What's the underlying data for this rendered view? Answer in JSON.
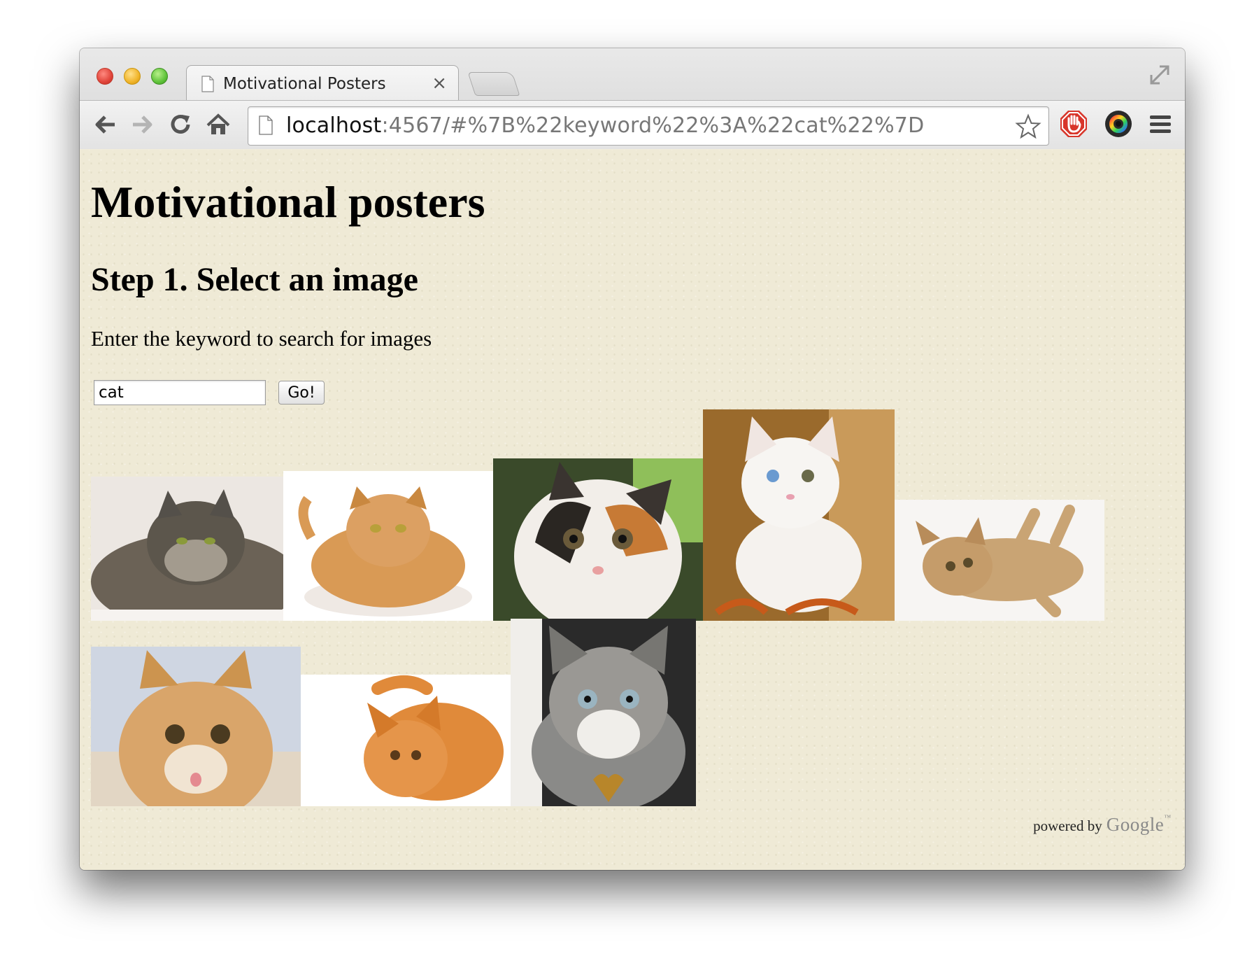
{
  "browser": {
    "tab_title": "Motivational Posters",
    "tab_close": "×",
    "url_host": "localhost",
    "url_rest": ":4567/#%7B%22keyword%22%3A%22cat%22%7D"
  },
  "page": {
    "title": "Motivational posters",
    "step_heading": "Step 1. Select an image",
    "prompt": "Enter the keyword to search for images",
    "search_value": "cat",
    "go_label": "Go!"
  },
  "results": [
    {
      "description": "fluffy grey tabby cat lying on white blanket"
    },
    {
      "description": "orange tabby cat crouching on white background"
    },
    {
      "description": "calico kitten close-up"
    },
    {
      "description": "white kitten on wooden chair"
    },
    {
      "description": "ginger kitten playing on its back"
    },
    {
      "description": "ginger kitten face close-up"
    },
    {
      "description": "orange cat looking up from above"
    },
    {
      "description": "grey tabby cat with heart tag"
    }
  ],
  "footer": {
    "powered_by": "powered by",
    "google": "Google",
    "tm": "™"
  },
  "colors": {
    "page_background": "#efead6",
    "chrome_background": "#dcdcdc"
  }
}
